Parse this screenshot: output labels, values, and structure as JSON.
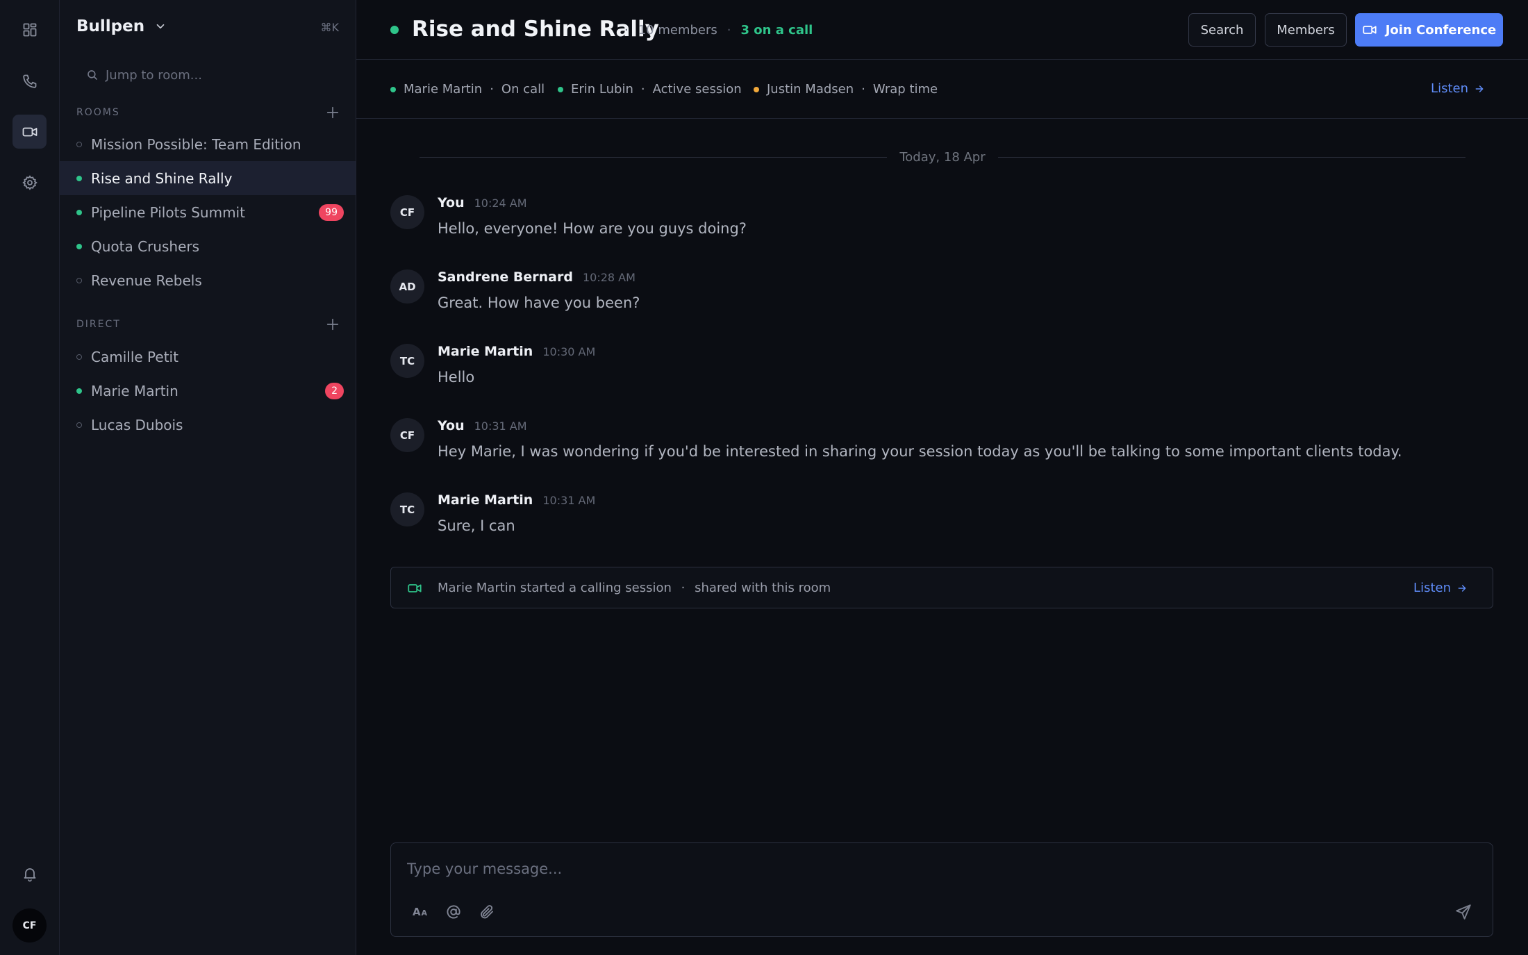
{
  "rail": {
    "icons": [
      "dashboard-icon",
      "phone-icon",
      "video-icon",
      "gear-icon",
      "bell-icon"
    ],
    "active": "video-icon",
    "avatar_initials": "CF"
  },
  "sidebar": {
    "workspace": "Bullpen",
    "shortcut": "⌘K",
    "search_placeholder": "Jump to room...",
    "rooms_label": "ROOMS",
    "rooms": [
      {
        "label": "Mission Possible: Team Edition",
        "online": false,
        "badge": ""
      },
      {
        "label": "Rise and Shine Rally",
        "online": true,
        "badge": "",
        "active": true
      },
      {
        "label": "Pipeline Pilots Summit",
        "online": true,
        "badge": "99"
      },
      {
        "label": "Quota Crushers",
        "online": true,
        "badge": ""
      },
      {
        "label": "Revenue Rebels",
        "online": false,
        "badge": ""
      }
    ],
    "direct_label": "DIRECT",
    "direct": [
      {
        "label": "Camille Petit",
        "online": false,
        "badge": ""
      },
      {
        "label": "Marie Martin",
        "online": true,
        "badge": "2"
      },
      {
        "label": "Lucas Dubois",
        "online": false,
        "badge": ""
      }
    ]
  },
  "header": {
    "title": "Rise and Shine Rally",
    "sep": "·",
    "members_count": "10 members",
    "on_call": "3 on a call",
    "search_btn": "Search",
    "members_btn": "Members",
    "join_btn": "Join Conference"
  },
  "statusbar": {
    "sep": "·",
    "agents": [
      {
        "name": "Marie Martin",
        "status": "On call",
        "color": "#2fc48a"
      },
      {
        "name": "Erin Lubin",
        "status": "Active session",
        "color": "#2fc48a"
      },
      {
        "name": "Justin Madsen",
        "status": "Wrap time",
        "color": "#f2a93b"
      }
    ],
    "listen": "Listen"
  },
  "chat": {
    "date_divider": "Today, 18 Apr",
    "messages": [
      {
        "initials": "CF",
        "author": "You",
        "time": "10:24 AM",
        "text": "Hello, everyone! How are you guys doing?"
      },
      {
        "initials": "AD",
        "author": "Sandrene Bernard",
        "time": "10:28 AM",
        "text": "Great. How have you been?"
      },
      {
        "initials": "TC",
        "author": "Marie Martin",
        "time": "10:30 AM",
        "text": "Hello"
      },
      {
        "initials": "CF",
        "author": "You",
        "time": "10:31 AM",
        "text": "Hey Marie, I was wondering if you'd be interested in sharing your session today as you'll be talking to some important clients today."
      },
      {
        "initials": "TC",
        "author": "Marie Martin",
        "time": "10:31 AM",
        "text": "Sure, I can"
      }
    ],
    "session": {
      "text": "Marie Martin started a calling session",
      "sep": "·",
      "shared": "shared with this room",
      "link": "Listen"
    }
  },
  "composer": {
    "placeholder": "Type your message...",
    "format_glyph": "Aa",
    "tools": [
      "format-text-icon",
      "mention-icon",
      "attach-icon"
    ],
    "send": "send-icon"
  },
  "colors": {
    "accent": "#4d7cf6",
    "online": "#2fc48a",
    "away": "#f2a93b",
    "badge": "#ef4560"
  }
}
